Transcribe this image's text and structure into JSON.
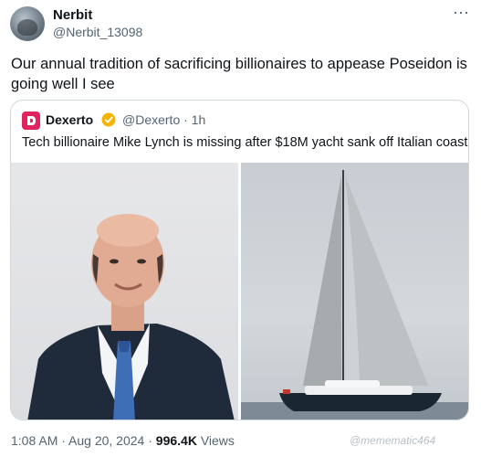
{
  "author": {
    "display_name": "Nerbit",
    "handle": "@Nerbit_13098"
  },
  "tweet": {
    "text": "Our annual tradition of sacrificing billionaires to appease Poseidon is going well I see"
  },
  "quote": {
    "name": "Dexerto",
    "handle_time": "@Dexerto · 1h",
    "text": "Tech billionaire Mike Lynch is missing after $18M yacht sank off Italian coast",
    "images": [
      "portrait-photo",
      "yacht-photo"
    ]
  },
  "footer": {
    "time_date": "1:08 AM · Aug 20, 2024 · ",
    "views_count": "996.4K",
    "views_label": " Views"
  },
  "watermark": "@memematic464",
  "colors": {
    "brand_dexerto": "#e0245e",
    "verified": "#f4b400",
    "secondary_text": "#536471"
  },
  "icons": {
    "more": "more-dots-icon",
    "verified": "verified-badge-icon",
    "logo": "dexerto-logo-icon"
  }
}
